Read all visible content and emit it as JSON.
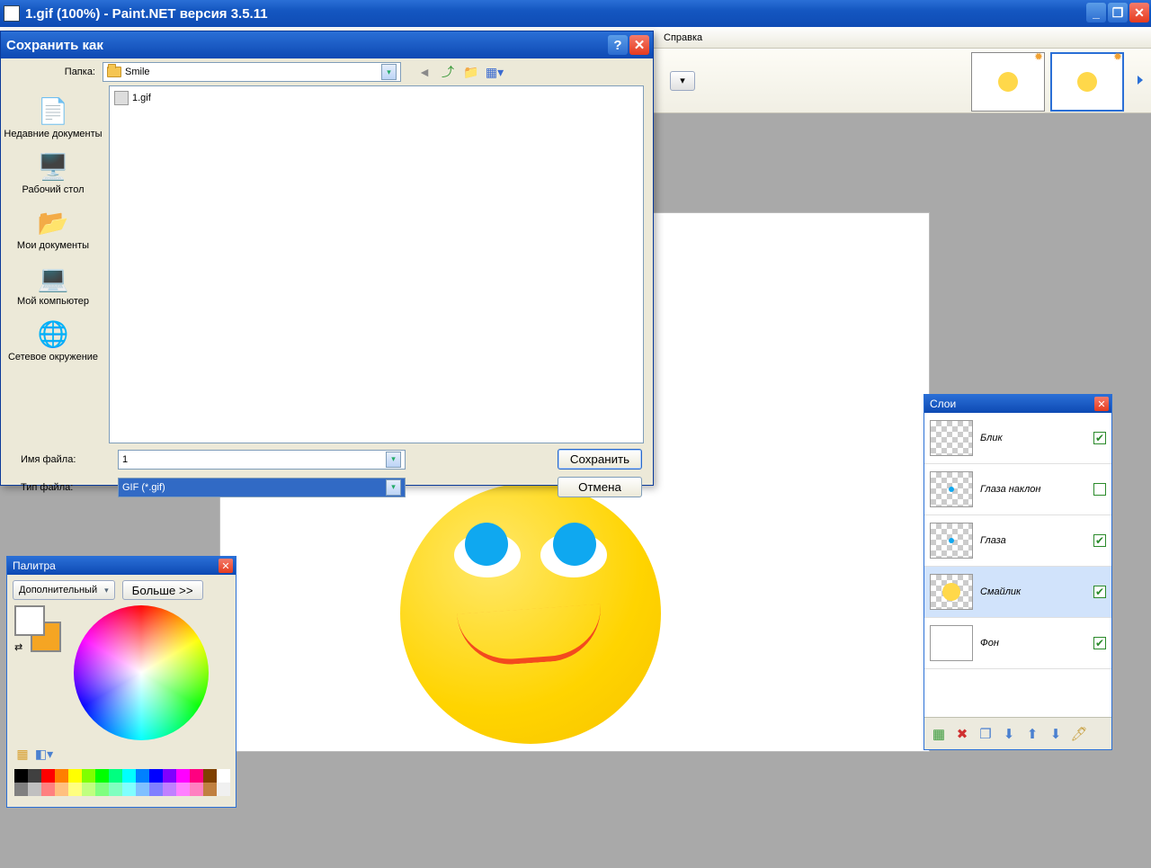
{
  "app": {
    "title": "1.gif (100%) - Paint.NET версия 3.5.11"
  },
  "menu": {
    "help": "Справка"
  },
  "save_dialog": {
    "title": "Сохранить как",
    "folder_label": "Папка:",
    "folder_value": "Smile",
    "places": {
      "recent": "Недавние документы",
      "desktop": "Рабочий стол",
      "mydocs": "Мои документы",
      "mycomp": "Мой компьютер",
      "network": "Сетевое окружение"
    },
    "files": [
      {
        "name": "1.gif"
      }
    ],
    "filename_label": "Имя файла:",
    "filename_value": "1",
    "filetype_label": "Тип файла:",
    "filetype_value": "GIF (*.gif)",
    "save_btn": "Сохранить",
    "cancel_btn": "Отмена"
  },
  "palette": {
    "title": "Палитра",
    "mode": "Дополнительный",
    "more": "Больше >>",
    "swatch_strip": [
      "#000000",
      "#404040",
      "#ff0000",
      "#ff7f00",
      "#ffff00",
      "#80ff00",
      "#00ff00",
      "#00ff80",
      "#00ffff",
      "#0080ff",
      "#0000ff",
      "#8000ff",
      "#ff00ff",
      "#ff0080",
      "#804000",
      "#ffffff",
      "#808080",
      "#c0c0c0",
      "#ff8080",
      "#ffc080",
      "#ffff80",
      "#c0ff80",
      "#80ff80",
      "#80ffc0",
      "#80ffff",
      "#80c0ff",
      "#8080ff",
      "#c080ff",
      "#ff80ff",
      "#ff80c0",
      "#c08040",
      "#f0f0f0"
    ]
  },
  "layers": {
    "title": "Слои",
    "items": [
      {
        "name": "Блик",
        "visible": true,
        "thumb": "checker"
      },
      {
        "name": "Глаза наклон",
        "visible": false,
        "thumb": "checker-dot"
      },
      {
        "name": "Глаза",
        "visible": true,
        "thumb": "checker-dot"
      },
      {
        "name": "Смайлик",
        "visible": true,
        "thumb": "smile",
        "selected": true
      },
      {
        "name": "Фон",
        "visible": true,
        "thumb": "white"
      }
    ]
  }
}
